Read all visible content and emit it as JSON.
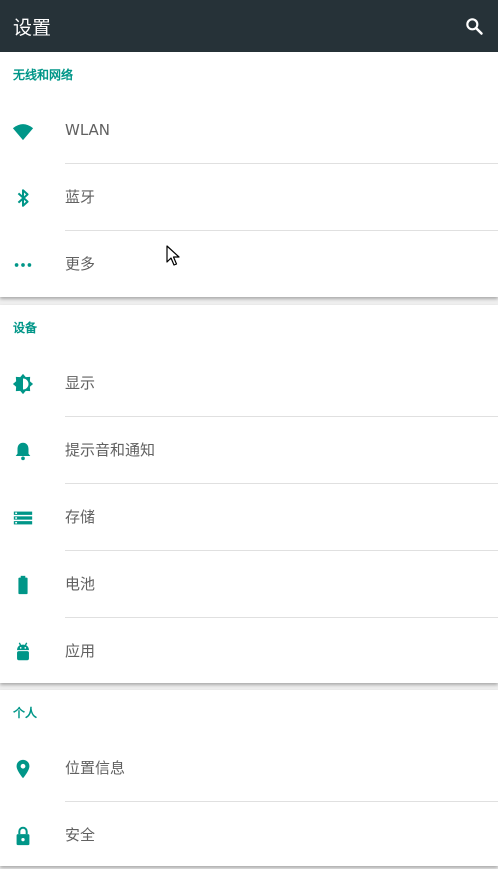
{
  "appbar": {
    "title": "设置",
    "search_icon": "search-icon"
  },
  "sections": [
    {
      "header": "无线和网络",
      "items": [
        {
          "label": "WLAN",
          "icon": "wifi-icon"
        },
        {
          "label": "蓝牙",
          "icon": "bluetooth-icon"
        },
        {
          "label": "更多",
          "icon": "more-dots-icon"
        }
      ]
    },
    {
      "header": "设备",
      "items": [
        {
          "label": "显示",
          "icon": "brightness-icon"
        },
        {
          "label": "提示音和通知",
          "icon": "bell-icon"
        },
        {
          "label": "存储",
          "icon": "storage-icon"
        },
        {
          "label": "电池",
          "icon": "battery-icon"
        },
        {
          "label": "应用",
          "icon": "android-icon"
        }
      ]
    },
    {
      "header": "个人",
      "items": [
        {
          "label": "位置信息",
          "icon": "location-icon"
        },
        {
          "label": "安全",
          "icon": "lock-icon"
        }
      ]
    }
  ],
  "colors": {
    "accent": "#009688",
    "appbar": "#263238",
    "background": "#eeeeee",
    "text": "#616161"
  }
}
